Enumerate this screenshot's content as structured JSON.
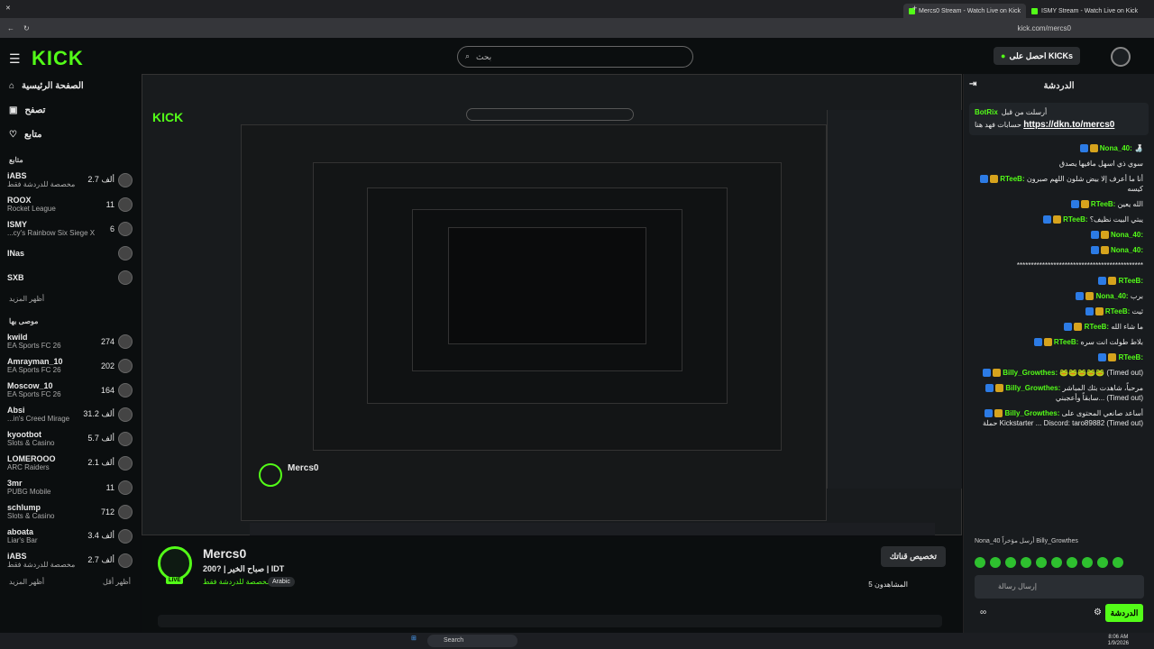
{
  "browser": {
    "tabs": [
      {
        "label": "Mercs0 Stream - Watch Live on Kick"
      },
      {
        "label": "ISMY Stream - Watch Live on Kick"
      }
    ],
    "url": "kick.com/mercs0"
  },
  "header": {
    "logo": "KICK",
    "search_placeholder": "بحث",
    "get_kicks": "احصل على KICKs"
  },
  "sidebar": {
    "nav": [
      {
        "label": "الصفحة الرئيسية"
      },
      {
        "label": "تصفح"
      },
      {
        "label": "متابع"
      }
    ],
    "following_title": "متابع",
    "following": [
      {
        "name": "iABS",
        "viewers": "2.7 ألف",
        "category": "مخصصة للدردشة فقط"
      },
      {
        "name": "ROOX",
        "viewers": "11",
        "category": "Rocket League"
      },
      {
        "name": "ISMY",
        "viewers": "6",
        "category": "...cy's Rainbow Six Siege X"
      },
      {
        "name": "INas",
        "viewers": "",
        "category": ""
      },
      {
        "name": "SXB",
        "viewers": "",
        "category": ""
      }
    ],
    "show_more": "أظهر المزيد",
    "recommended_title": "موصى بها",
    "recommended": [
      {
        "name": "kwild",
        "viewers": "274",
        "category": "EA Sports FC 26"
      },
      {
        "name": "Amrayman_10",
        "viewers": "202",
        "category": "EA Sports FC 26"
      },
      {
        "name": "Moscow_10",
        "viewers": "164",
        "category": "EA Sports FC 26"
      },
      {
        "name": "Absi",
        "viewers": "31.2 ألف",
        "category": "...in's Creed Mirage"
      },
      {
        "name": "kyootbot",
        "viewers": "5.7 ألف",
        "category": "Slots & Casino"
      },
      {
        "name": "LOMEROOO",
        "viewers": "2.1 ألف",
        "category": "ARC Raiders"
      },
      {
        "name": "3mr",
        "viewers": "11",
        "category": "PUBG Mobile"
      },
      {
        "name": "schlump",
        "viewers": "712",
        "category": "Slots & Casino"
      },
      {
        "name": "aboata",
        "viewers": "3.4 ألف",
        "category": "Liar's Bar"
      },
      {
        "name": "iABS",
        "viewers": "2.7 ألف",
        "category": "مخصصة للدردشة فقط"
      }
    ],
    "show_more2": "أظهر المزيد",
    "show_less": "أظهر أقل"
  },
  "stream": {
    "channel": "Mercs0",
    "title": "صباح الخير | ?200 | IDT",
    "category": "مخصصة للدردشة فقط",
    "tag": "Arabic",
    "viewers": "المشاهدون 5",
    "live": "LIVE",
    "clip_button": "تخصيص قناتك"
  },
  "chat": {
    "title": "الدردشة",
    "pinned_by": "أرسلت من قبل",
    "pinned_user": "BotRix",
    "pinned_text": "حسابات فهد هنا",
    "pinned_link": "https://dkn.to/mercs0",
    "messages": [
      {
        "user": "Nona_40:",
        "text": "🍶"
      },
      {
        "user": "",
        "text": "سوي ذي اسهل مافيها يصدق"
      },
      {
        "user": "RTeeB:",
        "text": "أنا ما أعرف إلا بيض شلون اللهم صبرون كيسه"
      },
      {
        "user": "RTeeB:",
        "text": "الله يعين"
      },
      {
        "user": "RTeeB:",
        "text": "يبتي البيت نظيف؟"
      },
      {
        "user": "Nona_40:",
        "text": ""
      },
      {
        "user": "Nona_40:",
        "text": ""
      },
      {
        "user": "",
        "text": "*********************************************"
      },
      {
        "user": "RTeeB:",
        "text": ""
      },
      {
        "user": "Nona_40:",
        "text": "برب"
      },
      {
        "user": "RTeeB:",
        "text": "ثيت"
      },
      {
        "user": "RTeeB:",
        "text": "ما شاء الله"
      },
      {
        "user": "RTeeB:",
        "text": "بلاط طولت انت سره"
      },
      {
        "user": "RTeeB:",
        "text": ""
      },
      {
        "user": "Billy_Growthes:",
        "text": "🐸🐸🐸🐸🐸 (Timed out)"
      },
      {
        "user": "Billy_Growthes:",
        "text": "مرحباً، شاهدت بثك المباشر سابقاً وأعجبني... (Timed out)"
      },
      {
        "user": "Billy_Growthes:",
        "text": "أساعد صانعي المحتوى على حملة Kickstarter ... Discord: taro89882 (Timed out)"
      }
    ],
    "gift_line": "Nona_40 أرسل مؤخراً Billy_Growthes",
    "input_placeholder": "إرسال رسالة",
    "send": "الدردشة"
  },
  "taskbar": {
    "search": "Search",
    "time": "8:06 AM",
    "date": "1/9/2026"
  }
}
